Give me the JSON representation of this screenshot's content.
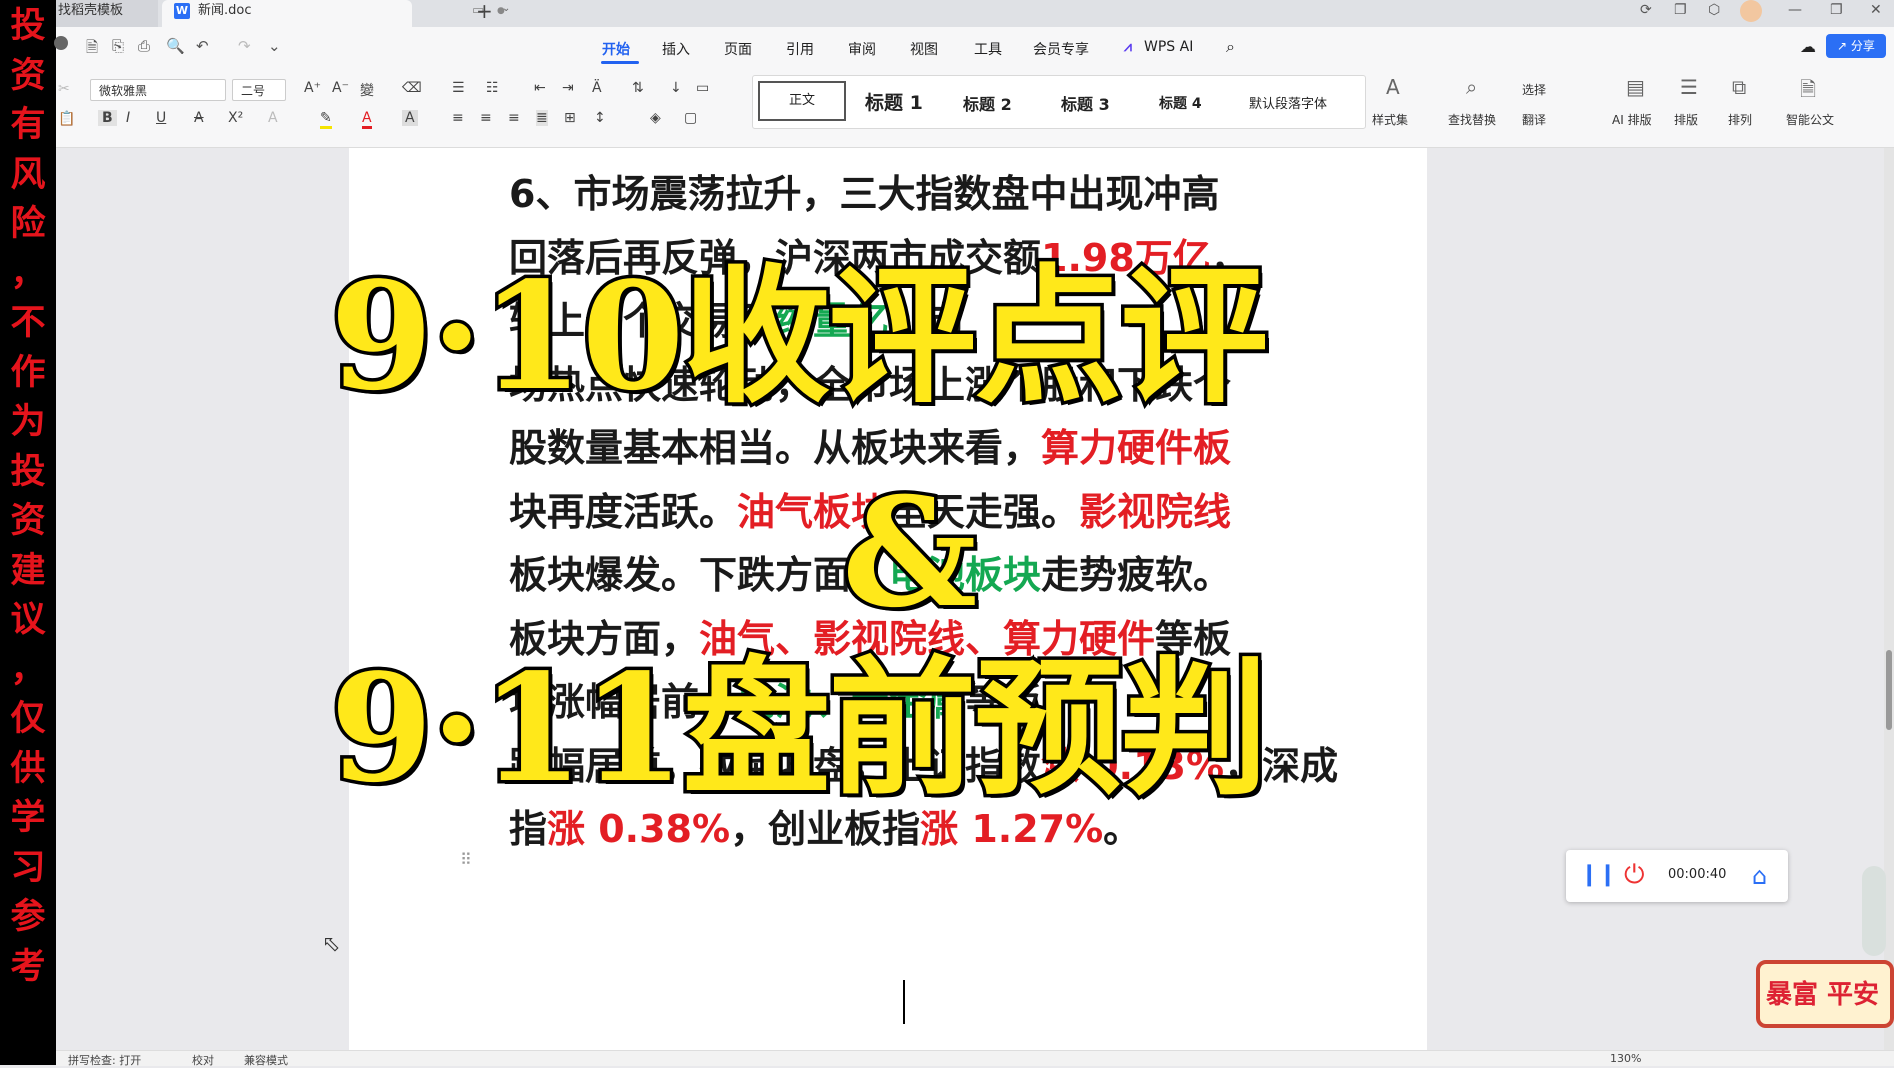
{
  "banner": {
    "chars": [
      "投",
      "资",
      "有",
      "风",
      "险",
      "，",
      "不",
      "作",
      "为",
      "投",
      "资",
      "建",
      "议",
      "，",
      "仅",
      "供",
      "学",
      "习",
      "参",
      "考"
    ]
  },
  "tabs": {
    "tab1_label": "找稻壳模板",
    "tab2_label": "新闻.doc",
    "doc_icon": "W",
    "new_tab": "+"
  },
  "menu": {
    "items": [
      "开始",
      "插入",
      "页面",
      "引用",
      "审阅",
      "视图",
      "工具",
      "会员专享",
      "WPS AI"
    ],
    "share": "分享"
  },
  "ribbon": {
    "font_name": "微软雅黑",
    "font_size": "二号",
    "styles": {
      "normal": "正文",
      "h1": "标题 1",
      "h2": "标题 2",
      "h3": "标题 3",
      "h4": "标题 4",
      "default_font": "默认段落字体"
    },
    "labels": {
      "style_set": "样式集",
      "find_replace": "查找替换",
      "select": "选择",
      "translate": "翻译",
      "ai_layout": "AI 排版",
      "layout": "排版",
      "arrange": "排列",
      "smart_doc": "智能公文"
    }
  },
  "document": {
    "lines": [
      [
        {
          "t": "6、市场震荡拉升，三大指数盘中出现冲高",
          "c": ""
        }
      ],
      [
        {
          "t": "回落后再反弹，沪深两市成交额",
          "c": ""
        },
        {
          "t": "1.98万亿",
          "c": "red"
        },
        {
          "t": "，",
          "c": ""
        }
      ],
      [
        {
          "t": "较上一个交易日",
          "c": ""
        },
        {
          "t": "缩量",
          "c": "green"
        },
        {
          "t": "亿",
          "c": "green"
        },
        {
          "t": "。市",
          "c": ""
        }
      ],
      [
        {
          "t": "场热点快速轮动，全市场上涨个股和下跌个",
          "c": ""
        }
      ],
      [
        {
          "t": "股数量基本相当。从板块来看，",
          "c": ""
        },
        {
          "t": "算力硬件板",
          "c": "red"
        }
      ],
      [
        {
          "t": "块再度活跃。",
          "c": ""
        },
        {
          "t": "油气板块",
          "c": "red"
        },
        {
          "t": "全天走强。",
          "c": ""
        },
        {
          "t": "影视院线",
          "c": "red"
        }
      ],
      [
        {
          "t": "板块爆发。下跌方面，",
          "c": ""
        },
        {
          "t": "电池板块",
          "c": "green"
        },
        {
          "t": "走势疲软。",
          "c": ""
        }
      ],
      [
        {
          "t": "板块方面，",
          "c": ""
        },
        {
          "t": "油气、影视院线、算力硬件",
          "c": "red"
        },
        {
          "t": "等板",
          "c": ""
        }
      ],
      [
        {
          "t": "块涨幅居前，",
          "c": ""
        },
        {
          "t": "电池、贵金属",
          "c": "green"
        },
        {
          "t": "等板",
          "c": ""
        }
      ],
      [
        {
          "t": "跌幅居前。截至收盘，上证指数",
          "c": ""
        },
        {
          "t": "涨 0.13%",
          "c": "red"
        },
        {
          "t": "，深成",
          "c": ""
        }
      ],
      [
        {
          "t": "指",
          "c": ""
        },
        {
          "t": "涨 0.38%",
          "c": "red"
        },
        {
          "t": "，创业板指",
          "c": ""
        },
        {
          "t": "涨 1.27%",
          "c": "red"
        },
        {
          "t": "。",
          "c": ""
        }
      ]
    ]
  },
  "overlay": {
    "line1": "9·10收评点评",
    "amp": "&",
    "line2": "9·11盘前预判"
  },
  "recorder": {
    "time": "00:00:40"
  },
  "sticker": {
    "text": "暴富 平安"
  },
  "status": {
    "spell": "拼写检查: 打开",
    "proof": "校对",
    "compat": "兼容模式",
    "zoom": "130%"
  }
}
